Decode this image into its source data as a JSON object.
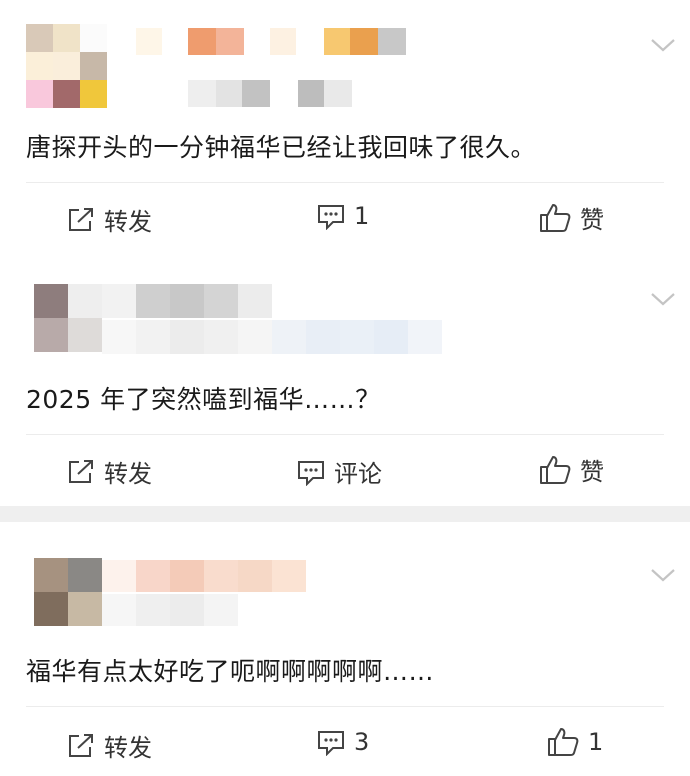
{
  "posts": [
    {
      "content": "唐探开头的一分钟福华已经让我回味了很久。",
      "actions": {
        "repost": "转发",
        "comment": "1",
        "like": "赞"
      }
    },
    {
      "content": "2025 年了突然嗑到福华……？",
      "actions": {
        "repost": "转发",
        "comment": "评论",
        "like": "赞"
      }
    },
    {
      "content": "福华有点太好吃了呃啊啊啊啊啊……",
      "actions": {
        "repost": "转发",
        "comment": "3",
        "like": "1"
      }
    }
  ],
  "icons": {
    "repost": "share-square-icon",
    "comment": "comment-bubble-icon",
    "like": "thumbs-up-icon",
    "expand": "chevron-down-icon"
  },
  "colors": {
    "text": "#1a1a1a",
    "muted": "#333333",
    "divider": "#ececec",
    "chevron": "#c4c4c4"
  }
}
